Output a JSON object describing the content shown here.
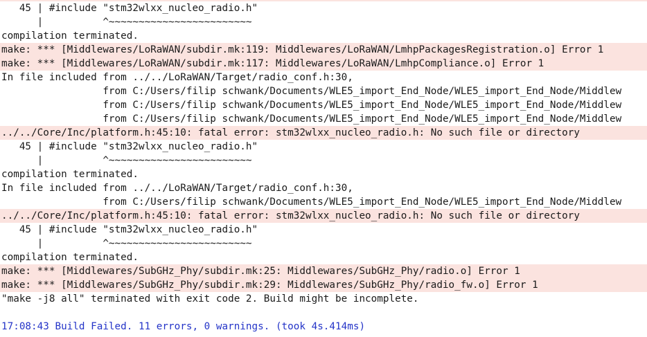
{
  "console": {
    "lines": [
      {
        "text": "   45 | #include \"stm32wlxx_nucleo_radio.h\"",
        "type": "normal"
      },
      {
        "text": "      |          ^~~~~~~~~~~~~~~~~~~~~~~~~",
        "type": "normal"
      },
      {
        "text": "compilation terminated.",
        "type": "normal"
      },
      {
        "text": "make: *** [Middlewares/LoRaWAN/subdir.mk:119: Middlewares/LoRaWAN/LmhpPackagesRegistration.o] Error 1",
        "type": "error"
      },
      {
        "text": "make: *** [Middlewares/LoRaWAN/subdir.mk:117: Middlewares/LoRaWAN/LmhpCompliance.o] Error 1",
        "type": "error"
      },
      {
        "text": "In file included from ../../LoRaWAN/Target/radio_conf.h:30,",
        "type": "normal"
      },
      {
        "text": "                 from C:/Users/filip schwank/Documents/WLE5_import_End_Node/WLE5_import_End_Node/Middlew",
        "type": "normal"
      },
      {
        "text": "                 from C:/Users/filip schwank/Documents/WLE5_import_End_Node/WLE5_import_End_Node/Middlew",
        "type": "normal"
      },
      {
        "text": "                 from C:/Users/filip schwank/Documents/WLE5_import_End_Node/WLE5_import_End_Node/Middlew",
        "type": "normal"
      },
      {
        "text": "../../Core/Inc/platform.h:45:10: fatal error: stm32wlxx_nucleo_radio.h: No such file or directory",
        "type": "error"
      },
      {
        "text": "   45 | #include \"stm32wlxx_nucleo_radio.h\"",
        "type": "normal"
      },
      {
        "text": "      |          ^~~~~~~~~~~~~~~~~~~~~~~~~",
        "type": "normal"
      },
      {
        "text": "compilation terminated.",
        "type": "normal"
      },
      {
        "text": "In file included from ../../LoRaWAN/Target/radio_conf.h:30,",
        "type": "normal"
      },
      {
        "text": "                 from C:/Users/filip schwank/Documents/WLE5_import_End_Node/WLE5_import_End_Node/Middlew",
        "type": "normal"
      },
      {
        "text": "../../Core/Inc/platform.h:45:10: fatal error: stm32wlxx_nucleo_radio.h: No such file or directory",
        "type": "error"
      },
      {
        "text": "   45 | #include \"stm32wlxx_nucleo_radio.h\"",
        "type": "normal"
      },
      {
        "text": "      |          ^~~~~~~~~~~~~~~~~~~~~~~~~",
        "type": "normal"
      },
      {
        "text": "compilation terminated.",
        "type": "normal"
      },
      {
        "text": "make: *** [Middlewares/SubGHz_Phy/subdir.mk:25: Middlewares/SubGHz_Phy/radio.o] Error 1",
        "type": "error"
      },
      {
        "text": "make: *** [Middlewares/SubGHz_Phy/subdir.mk:29: Middlewares/SubGHz_Phy/radio_fw.o] Error 1",
        "type": "error"
      },
      {
        "text": "\"make -j8 all\" terminated with exit code 2. Build might be incomplete.",
        "type": "normal"
      },
      {
        "text": "",
        "type": "blank"
      },
      {
        "text": "17:08:43 Build Failed. 11 errors, 0 warnings. (took 4s.414ms)",
        "type": "status"
      }
    ],
    "colors": {
      "error_background": "#fbe3df",
      "status_text": "#2434c8",
      "text": "#1a1a1a"
    }
  }
}
